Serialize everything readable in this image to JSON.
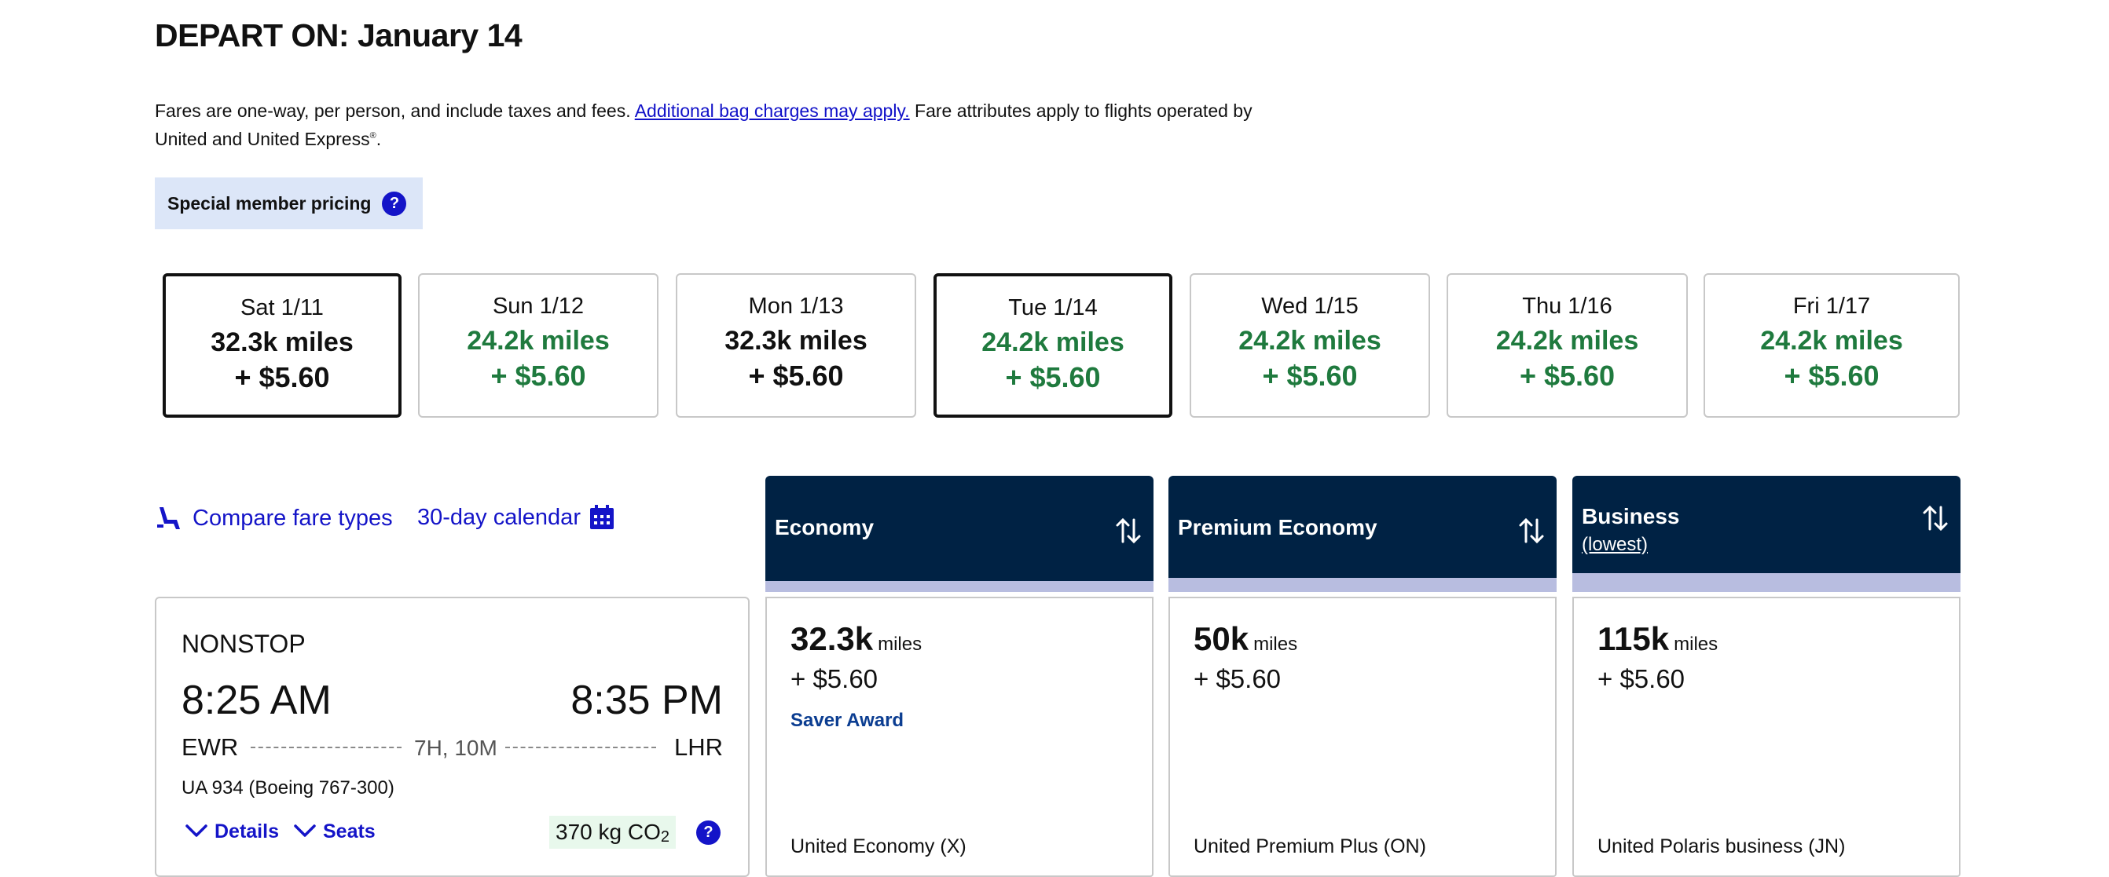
{
  "page": {
    "title": "DEPART ON: January 14",
    "info_text_1": "Fares are one-way, per person, and include taxes and fees. ",
    "info_link": "Additional bag charges may apply.",
    "info_text_2": " Fare attributes apply to flights operated by",
    "info_text_3": "United and United Express",
    "info_sup": "®",
    "info_text_4": ".",
    "special_pricing_label": "Special member pricing",
    "help_glyph": "?"
  },
  "colors": {
    "link_blue": "#1414c8",
    "green_price": "#1f7a3e",
    "header_navy": "#002244",
    "band_lavender": "#b8bde0",
    "pill_bg": "#dce6f8"
  },
  "date_strip": [
    {
      "day": "Sat 1/11",
      "miles": "32.3k miles",
      "price": "+ $5.60",
      "selected": true,
      "green": false
    },
    {
      "day": "Sun 1/12",
      "miles": "24.2k miles",
      "price": "+ $5.60",
      "selected": false,
      "green": true
    },
    {
      "day": "Mon 1/13",
      "miles": "32.3k miles",
      "price": "+ $5.60",
      "selected": false,
      "green": false
    },
    {
      "day": "Tue 1/14",
      "miles": "24.2k miles",
      "price": "+ $5.60",
      "selected": true,
      "green": true
    },
    {
      "day": "Wed 1/15",
      "miles": "24.2k miles",
      "price": "+ $5.60",
      "selected": false,
      "green": true
    },
    {
      "day": "Thu 1/16",
      "miles": "24.2k miles",
      "price": "+ $5.60",
      "selected": false,
      "green": true
    },
    {
      "day": "Fri 1/17",
      "miles": "24.2k miles",
      "price": "+ $5.60",
      "selected": false,
      "green": true
    }
  ],
  "links": {
    "compare_fare_types": "Compare fare types",
    "calendar_30_day": "30-day calendar"
  },
  "cabins": [
    {
      "name": "Economy",
      "sub": "",
      "miles": "32.3k",
      "miles_unit": "miles",
      "price": "+ $5.60",
      "award": "Saver Award",
      "class_name": "United Economy (X)"
    },
    {
      "name": "Premium Economy",
      "sub": "",
      "miles": "50k",
      "miles_unit": "miles",
      "price": "+ $5.60",
      "award": "",
      "class_name": "United Premium Plus (ON)"
    },
    {
      "name": "Business",
      "sub": "(lowest)",
      "miles": "115k",
      "miles_unit": "miles",
      "price": "+ $5.60",
      "award": "",
      "class_name": "United Polaris business (JN)"
    }
  ],
  "flight": {
    "stops": "NONSTOP",
    "depart_time": "8:25 AM",
    "arrive_time": "8:35 PM",
    "origin": "EWR",
    "destination": "LHR",
    "duration": "7H, 10M",
    "flight_number": "UA 934 (Boeing 767-300)",
    "details_label": "Details",
    "seats_label": "Seats",
    "co2_prefix": "370 kg CO",
    "co2_sub": "2"
  }
}
